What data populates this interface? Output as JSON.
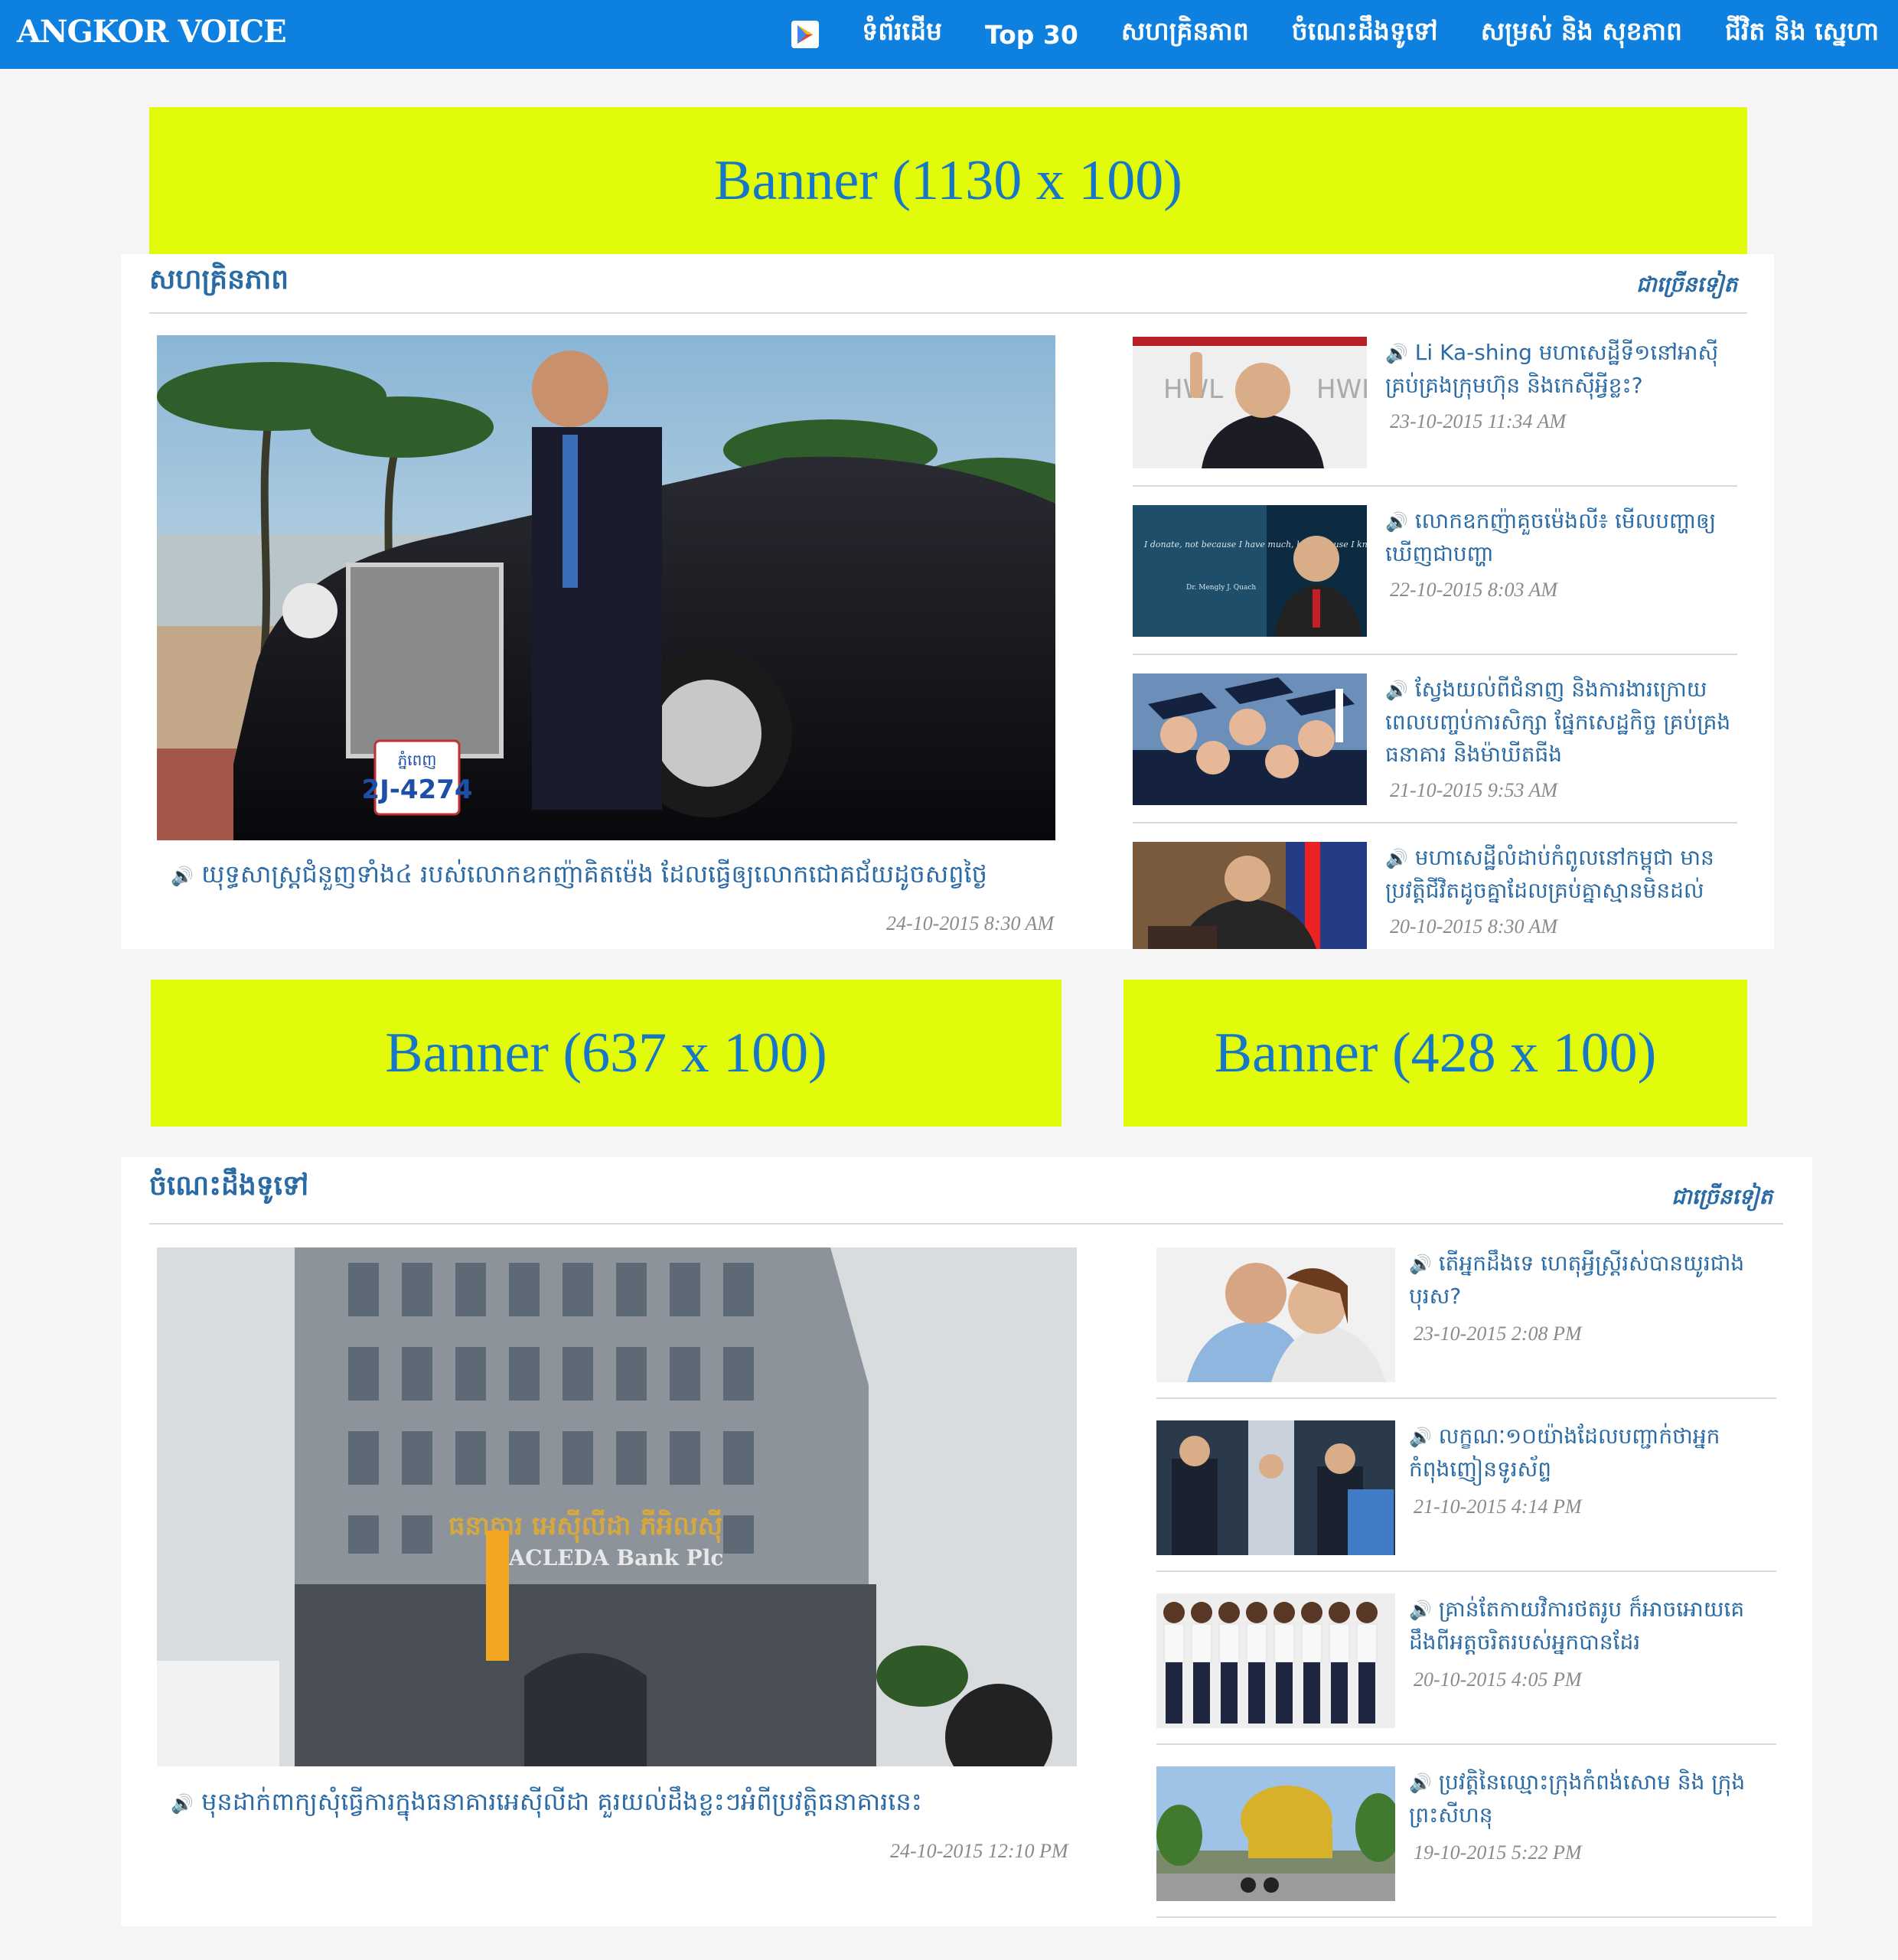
{
  "site": {
    "logo": "ANGKOR VOICE",
    "nav": [
      "ទំព័រដើម",
      "Top 30",
      "សហគ្រិនភាព",
      "ចំណេះដឹងទូទៅ",
      "សម្រស់ និង សុខភាព",
      "ជីវិត និង ស្នេហា"
    ],
    "play_icon": "google-play-icon"
  },
  "banners": {
    "top": "Banner (1130 x 100)",
    "mid_left": "Banner (637 x 100)",
    "mid_right": "Banner (428 x 100)"
  },
  "section1": {
    "title": "សហគ្រិនភាព",
    "more": "ជាច្រើនទៀត",
    "main": {
      "caption": "យុទ្ធសាស្ត្រជំនួញទាំង៤ របស់លោកឧកញ៉ាគិតម៉េង ដែលធ្វើឲ្យលោកជោគជ័យដូចសព្វថ្ងៃ",
      "date": "24-10-2015 8:30 AM",
      "plate_top": "ភ្នំពេញ",
      "plate": "2J-4274"
    },
    "items": [
      {
        "title": "Li Ka-shing មហាសេដ្ឋីទី១នៅអាស៊ីគ្រប់គ្រងក្រុមហ៊ុន និងកេស៊ីអ្វីខ្លះ?",
        "date": "23-10-2015 11:34 AM",
        "hwl": "HWL"
      },
      {
        "title": "លោកឧកញ៉ាគួចម៉េងលី៖ មើលបញ្ហាឲ្យឃើញជាបញ្ហា",
        "date": "22-10-2015 8:03 AM",
        "quote": "I donate, not because I have much, but because I know the feeling of having nothing.",
        "quote_author": "Dr. Mengly J. Quach"
      },
      {
        "title": "ស្វែងយល់ពីជំនាញ និងការងារក្រោយពេលបញ្ចប់ការសិក្សា ផ្នែកសេដ្ឋកិច្ច គ្រប់គ្រងធនាគារ និងម៉ាឃីតធីង",
        "date": "21-10-2015 9:53 AM"
      },
      {
        "title": "មហាសេដ្ឋីលំដាប់កំពូលនៅកម្ពុជា មានប្រវត្តិជីវិតដូចគ្នាដែលគ្រប់គ្នាស្មានមិនដល់",
        "date": "20-10-2015 8:30 AM"
      }
    ]
  },
  "section2": {
    "title": "ចំណេះដឹងទូទៅ",
    "more": "ជាច្រើនទៀត",
    "main": {
      "caption": "មុនដាក់ពាក្យសុំធ្វើការក្នុងធនាគារអេស៊ីលីដា គួរយល់ដឹងខ្លះៗអំពីប្រវត្តិធនាគារនេះ",
      "date": "24-10-2015 12:10 PM",
      "bank_kh": "ធនាគារ អេស៊ីលីដា ភីអិលស៊ី",
      "bank_en": "ACLEDA Bank Plc"
    },
    "items": [
      {
        "title": "តើអ្នកដឹងទេ ហេតុអ្វីស្ត្រីរស់បានយូរជាងបុរស?",
        "date": "23-10-2015 2:08 PM"
      },
      {
        "title": "លក្ខណៈ១០យ៉ាងដែលបញ្ជាក់ថាអ្នកកំពុងញៀនទូរស័ព្ទ",
        "date": "21-10-2015 4:14 PM"
      },
      {
        "title": "គ្រាន់តែកាយវិការថតរូប ក៏អាចអោយគេដឹងពីអត្តចរិតរបស់អ្នកបានដែរ",
        "date": "20-10-2015 4:05 PM"
      },
      {
        "title": "ប្រវត្តិនៃឈ្មោះក្រុងកំពង់សោម និង ក្រុងព្រះសីហនុ",
        "date": "19-10-2015 5:22 PM"
      }
    ]
  }
}
